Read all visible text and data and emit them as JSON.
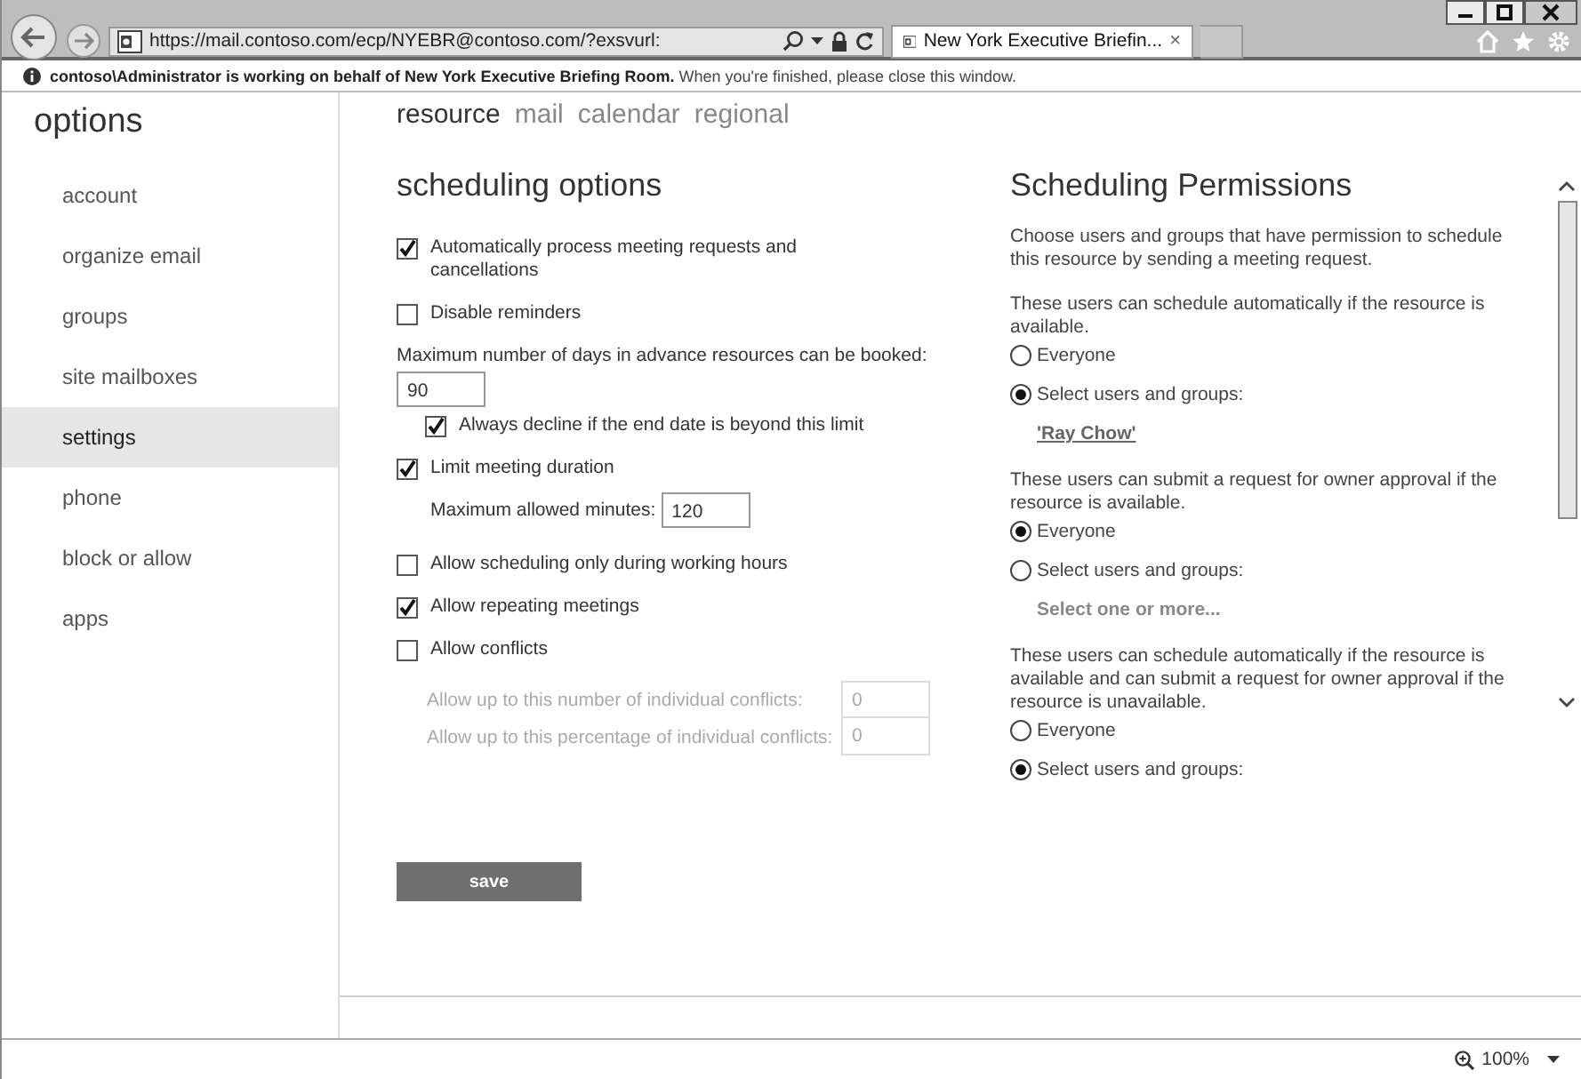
{
  "browser": {
    "address": "https://mail.contoso.com/ecp/NYEBR@contoso.com/?exsvurl:",
    "tab_title": "New York Executive Briefin...",
    "tab_close": "×"
  },
  "info_bar": "**contoso\\Administrator is working on behalf of New York Executive Briefing Room.** When you're finished, please close this window.",
  "sidebar": {
    "title": "options",
    "items": [
      {
        "label": "account",
        "selected": false
      },
      {
        "label": "organize email",
        "selected": false
      },
      {
        "label": "groups",
        "selected": false
      },
      {
        "label": "site mailboxes",
        "selected": false
      },
      {
        "label": "settings",
        "selected": true
      },
      {
        "label": "phone",
        "selected": false
      },
      {
        "label": "block or allow",
        "selected": false
      },
      {
        "label": "apps",
        "selected": false
      }
    ]
  },
  "tabs": [
    {
      "label": "resource",
      "selected": true
    },
    {
      "label": "mail",
      "selected": false
    },
    {
      "label": "calendar",
      "selected": false
    },
    {
      "label": "regional",
      "selected": false
    }
  ],
  "scheduling_options": {
    "title": "scheduling options",
    "items": [
      {
        "kind": "checkbox",
        "label": "Automatically process meeting requests and cancellations",
        "checked": true
      },
      {
        "kind": "checkbox",
        "label": "Disable reminders",
        "checked": false
      },
      {
        "kind": "field",
        "label": "Maximum number of days in advance resources can be booked:",
        "value": "90"
      },
      {
        "kind": "sub_checkbox",
        "label": "Always decline if the end date is beyond this limit",
        "checked": true
      },
      {
        "kind": "checkbox",
        "label": "Limit meeting duration",
        "checked": true
      },
      {
        "kind": "inline_field",
        "label": "Maximum allowed minutes:",
        "value": "120"
      },
      {
        "kind": "checkbox",
        "label": "Allow scheduling only during working hours",
        "checked": false
      },
      {
        "kind": "checkbox",
        "label": "Allow repeating meetings",
        "checked": true
      },
      {
        "kind": "checkbox",
        "label": "Allow conflicts",
        "checked": false
      },
      {
        "kind": "disabled_field",
        "label": "Allow up to this number of individual conflicts:",
        "value": "0"
      },
      {
        "kind": "disabled_field",
        "label": "Allow up to this percentage of individual conflicts:",
        "value": "0"
      }
    ]
  },
  "save_button": "save",
  "permissions": {
    "title": "Scheduling Permissions",
    "description": "Choose users and groups that have permission to schedule this resource by sending a meeting request.",
    "groups": [
      {
        "text": "These users can schedule automatically if the resource is available.",
        "options": [
          {
            "label": "Everyone",
            "selected": false
          },
          {
            "label": "Select users and groups:",
            "selected": true
          }
        ],
        "value": {
          "kind": "link",
          "text": "'Ray Chow'"
        }
      },
      {
        "text": "These users can submit a request for owner approval if the resource is available.",
        "options": [
          {
            "label": "Everyone",
            "selected": true
          },
          {
            "label": "Select users and groups:",
            "selected": false
          }
        ],
        "value": {
          "kind": "placeholder",
          "text": "Select one or more..."
        }
      },
      {
        "text": "These users can schedule automatically if the resource is available and can submit a request for owner approval if the resource is unavailable.",
        "options": [
          {
            "label": "Everyone",
            "selected": false
          },
          {
            "label": "Select users and groups:",
            "selected": true
          }
        ]
      }
    ]
  },
  "status_bar": {
    "zoom": "100%"
  }
}
